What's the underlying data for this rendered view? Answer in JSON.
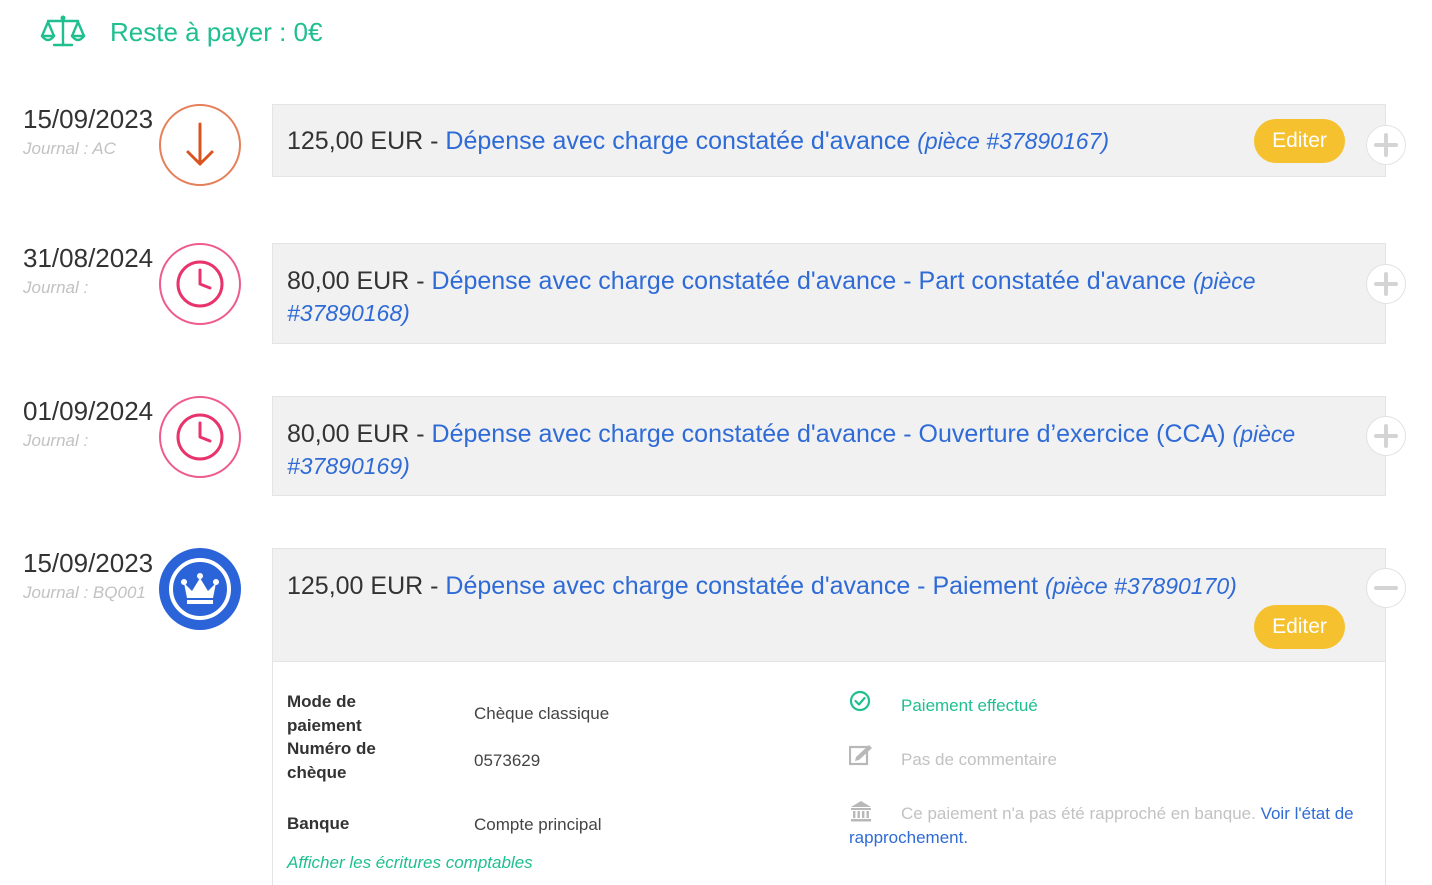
{
  "header": {
    "icon": "scale-icon",
    "title": "Reste à payer : 0€",
    "color": "#1fbf8f"
  },
  "entries": [
    {
      "date": "15/09/2023",
      "journal": "Journal : AC",
      "icon": "arrow-down-icon",
      "amount": "125,00 EUR",
      "separator": " - ",
      "label": "Dépense avec charge constatée d'avance",
      "piece": "(pièce #37890167)",
      "edit_label": "Editer",
      "toggle": "plus-icon"
    },
    {
      "date": "31/08/2024",
      "journal": "Journal :",
      "icon": "clock-icon",
      "amount": "80,00 EUR",
      "separator": " - ",
      "label": "Dépense avec charge constatée d'avance - Part constatée d'avance",
      "piece": "(pièce #37890168)",
      "toggle": "plus-icon"
    },
    {
      "date": "01/09/2024",
      "journal": "Journal :",
      "icon": "clock-icon",
      "amount": "80,00 EUR",
      "separator": " - ",
      "label": "Dépense avec charge constatée d'avance - Ouverture d’exercice (CCA)",
      "piece": "(pièce #37890169)",
      "toggle": "plus-icon"
    },
    {
      "date": "15/09/2023",
      "journal": "Journal : BQ001",
      "icon": "crown-icon",
      "amount": "125,00 EUR",
      "separator": " - ",
      "label": "Dépense avec charge constatée d'avance - Paiement",
      "piece": "(pièce #37890170)",
      "edit_label": "Editer",
      "toggle": "minus-icon"
    }
  ],
  "details": {
    "payment_mode_label": "Mode de paiement",
    "payment_mode_value": "Chèque classique",
    "cheque_number_label": "Numéro de chèque",
    "cheque_number_value": "0573629",
    "bank_label": "Banque",
    "bank_value": "Compte principal",
    "show_entries_link": "Afficher les écritures comptables",
    "status_paid": "Paiement effectué",
    "comment": "Pas de commentaire",
    "bank_reconcile_text": "Ce paiement n'a pas été rapproché en banque.",
    "bank_reconcile_link": "Voir l'état de rapprochement",
    "bank_reconcile_end": "."
  },
  "colors": {
    "accent_green": "#1fbf8f",
    "link_blue": "#2f6bd6",
    "edit_yellow": "#f5c12e",
    "orange": "#e5805a",
    "pink": "#ee5c8b",
    "blue": "#2b63d8"
  }
}
